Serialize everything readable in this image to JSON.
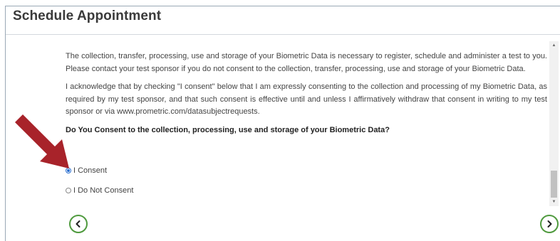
{
  "page": {
    "title": "Schedule Appointment"
  },
  "content": {
    "paragraph1": "The collection, transfer, processing, use and storage of your Biometric Data is necessary to register, schedule and administer a test to you. Please contact your test sponsor if you do not consent to the collection, transfer, processing, use and storage of your Biometric Data.",
    "paragraph2": "I acknowledge that by checking \"I consent\" below that I am expressly consenting to the collection and processing of my Biometric Data, as required by my test sponsor, and that such consent is effective until and unless I affirmatively withdraw that consent in writing to my test sponsor or via www.prometric.com/datasubjectrequests.",
    "question": "Do You Consent to the collection, processing, use and storage of your Biometric Data?"
  },
  "consent_options": [
    {
      "label": "I Consent",
      "selected": true
    },
    {
      "label": "I Do Not Consent",
      "selected": false
    }
  ],
  "navigation": {
    "back_icon": "chevron-left-icon",
    "next_icon": "chevron-right-icon",
    "accent_color": "#4f9a3e"
  },
  "annotation": {
    "arrow_color": "#a8232a"
  }
}
